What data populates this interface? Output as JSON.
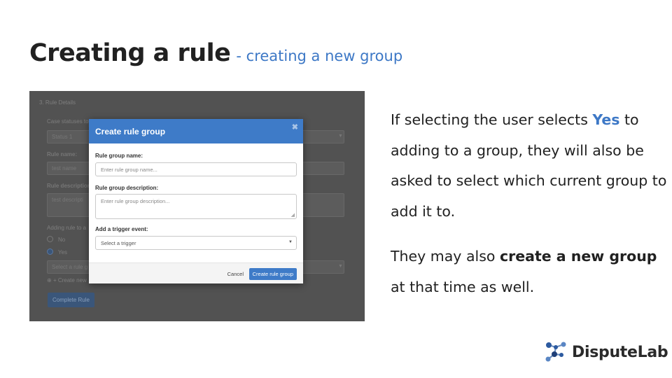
{
  "slide": {
    "title": "Creating a rule",
    "subtitle": "- creating a new group"
  },
  "background_form": {
    "section_title": "3. Rule Details",
    "case_statuses_label": "Case statuses to",
    "status_value": "Status 1",
    "rule_name_label": "Rule name:",
    "rule_name_value": "test name",
    "rule_description_label": "Rule description:",
    "rule_description_value": "test descripti",
    "adding_rule_label": "Adding rule to a",
    "option_no": "No",
    "option_yes": "Yes",
    "select_group_placeholder": "Select a rule g",
    "create_new_link": "+ Create new",
    "complete_button": "Complete Rule"
  },
  "modal": {
    "title": "Create rule group",
    "close_icon": "close-icon",
    "group_name_label": "Rule group name:",
    "group_name_placeholder": "Enter rule group name...",
    "group_description_label": "Rule group description:",
    "group_description_placeholder": "Enter rule group description...",
    "trigger_label": "Add a trigger event:",
    "trigger_placeholder": "Select a trigger",
    "cancel_label": "Cancel",
    "create_label": "Create rule group"
  },
  "description": {
    "p1_a": "If selecting the user selects ",
    "p1_highlight": "Yes",
    "p1_b": " to adding to a group, they will also be asked to select which current group to add it to.",
    "p2_a": "They may also ",
    "p2_bold": "create a new group",
    "p2_b": " at that time as well."
  },
  "logo": {
    "text": "DisputeLab",
    "icon": "network-nodes-icon",
    "color": "#2c5aa0"
  },
  "colors": {
    "accent": "#3d78c6",
    "modal_header": "#3e7bc8",
    "overlay": "#525252"
  }
}
